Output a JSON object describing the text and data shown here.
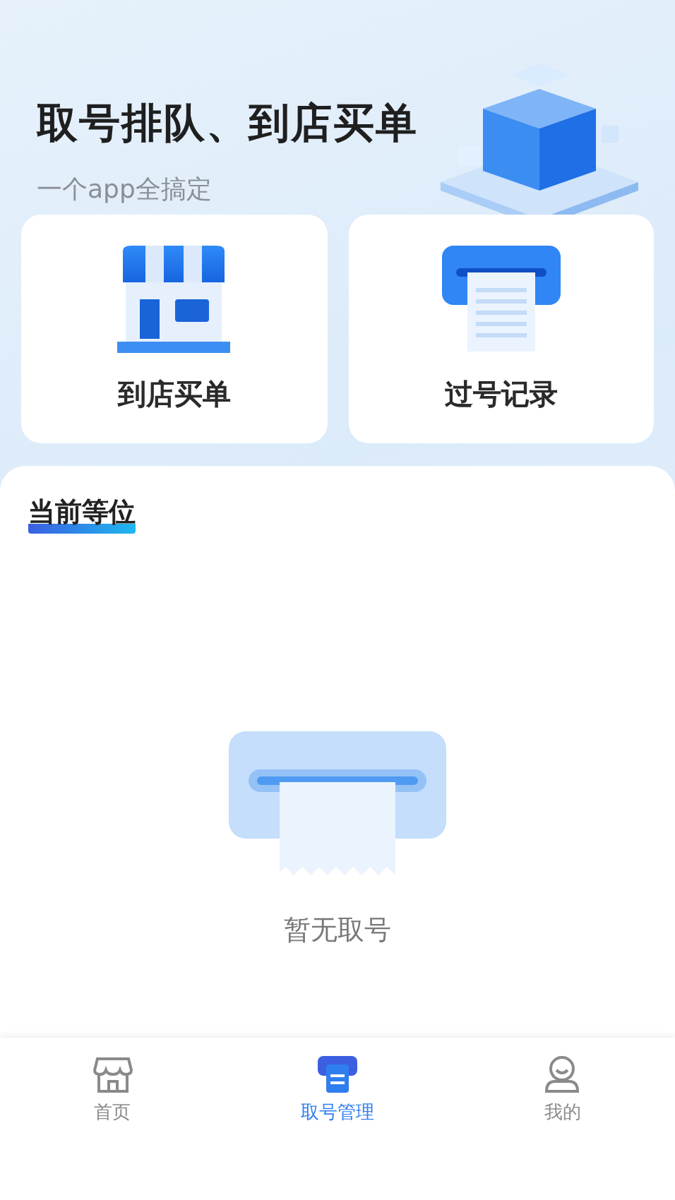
{
  "hero": {
    "title": "取号排队、到店买单",
    "subtitle": "一个app全搞定"
  },
  "cards": [
    {
      "kind": "store",
      "label": "到店买单"
    },
    {
      "kind": "ticket",
      "label": "过号记录"
    }
  ],
  "panel": {
    "title": "当前等位",
    "empty_text": "暂无取号"
  },
  "tabs": [
    {
      "kind": "home",
      "label": "首页",
      "selected": false
    },
    {
      "kind": "queue",
      "label": "取号管理",
      "selected": true
    },
    {
      "kind": "profile",
      "label": "我的",
      "selected": false
    }
  ]
}
